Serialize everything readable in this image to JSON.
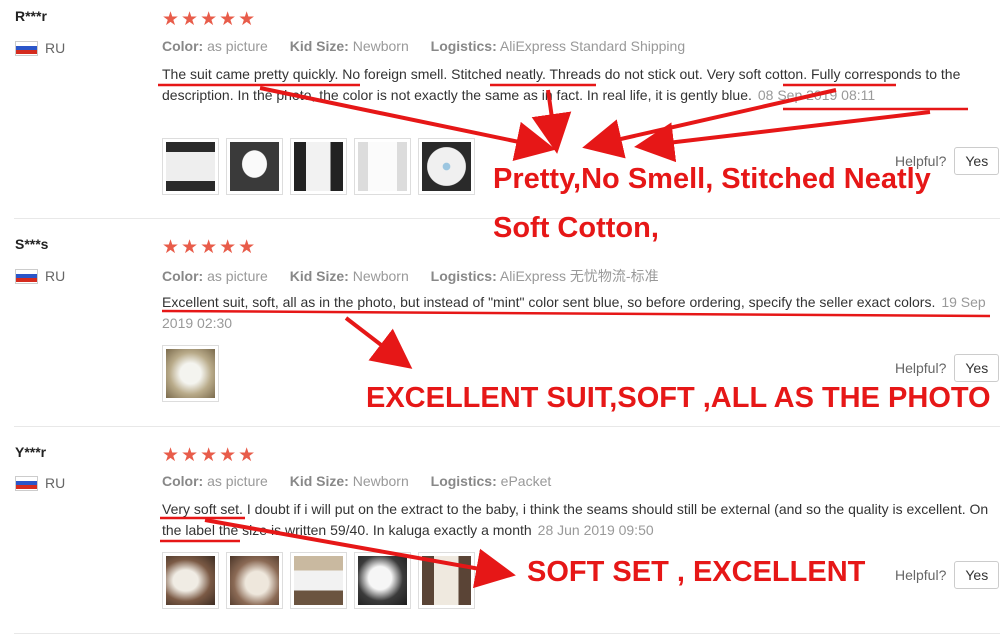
{
  "labels": {
    "color": "Color:",
    "kid_size": "Kid Size:",
    "logistics": "Logistics:",
    "helpful": "Helpful?",
    "yes": "Yes"
  },
  "stars": "★★★★★",
  "reviews": [
    {
      "user": "R***r",
      "country": "RU",
      "rating": 5,
      "color": "as picture",
      "kid_size": "Newborn",
      "logistics": "AliExpress Standard Shipping",
      "text": "The suit came pretty quickly. No foreign smell. Stitched neatly. Threads do not stick out. Very soft cotton. Fully corresponds to the description. In the photo, the color is not exactly the same as in fact. In real life, it is gently blue.",
      "date": "08 Sep 2019 08:11",
      "photo_count": 5
    },
    {
      "user": "S***s",
      "country": "RU",
      "rating": 5,
      "color": "as picture",
      "kid_size": "Newborn",
      "logistics": "AliExpress 无忧物流-标准",
      "text": "Excellent suit, soft, all as in the photo, but instead of \"mint\" color sent blue, so before ordering, specify the seller exact colors.",
      "date": "19 Sep 2019 02:30",
      "photo_count": 1
    },
    {
      "user": "Y***r",
      "country": "RU",
      "rating": 5,
      "color": "as picture",
      "kid_size": "Newborn",
      "logistics": "ePacket",
      "text": "Very soft set. I doubt if i will put on the extract to the baby, i think the seams should still be external (and so the quality is excellent. On the label the size is written 59/40. In kaluga exactly a month",
      "date": "28 Jun 2019 09:50",
      "photo_count": 5
    }
  ],
  "annotations": {
    "a1_line1": "Pretty,No Smell, Stitched Neatly",
    "a1_line2": "Soft Cotton,",
    "a2": "EXCELLENT SUIT,SOFT ,ALL AS THE PHOTO",
    "a3": "SOFT SET , EXCELLENT"
  },
  "colors": {
    "star": "#e85c4a",
    "annotation": "#e61717",
    "flag_white": "#ffffff",
    "flag_blue": "#2a55c9",
    "flag_red": "#d52b1e"
  }
}
